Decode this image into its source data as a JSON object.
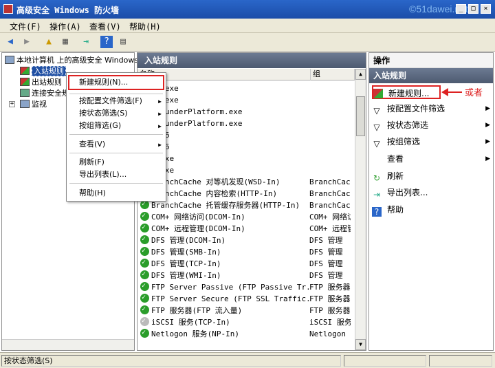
{
  "window": {
    "title": "高级安全 Windows 防火墙",
    "watermark": "©51dawei.net",
    "buttons": {
      "minimize": "_",
      "maximize": "□",
      "close": "×"
    }
  },
  "menu": [
    "文件(F)",
    "操作(A)",
    "查看(V)",
    "帮助(H)"
  ],
  "tree": {
    "root": "本地计算机 上的高级安全 Windows 防火墙",
    "items": [
      "入站规则",
      "出站规则",
      "连接安全规则",
      "监视"
    ]
  },
  "center": {
    "header": "入站规则",
    "columns": {
      "name": "名称",
      "group": "组"
    },
    "rows": [
      {
        "name": "se.exe",
        "group": ""
      },
      {
        "name": "se.exe",
        "group": ""
      },
      {
        "name": "iThunderPlatform.exe",
        "group": ""
      },
      {
        "name": "iThunderPlatform.exe",
        "group": ""
      },
      {
        "name": "QL56",
        "group": ""
      },
      {
        "name": "QL56",
        "group": ""
      },
      {
        "name": "p.exe",
        "group": ""
      },
      {
        "name": "p.exe",
        "group": ""
      },
      {
        "name": "BranchCache 对等机发现(WSD-In)",
        "group": "BranchCache"
      },
      {
        "name": "BranchCache 内容检索(HTTP-In)",
        "group": "BranchCache"
      },
      {
        "name": "BranchCache 托管缓存服务器(HTTP-In)",
        "group": "BranchCache"
      },
      {
        "name": "COM+ 网络访问(DCOM-In)",
        "group": "COM+ 网络访问"
      },
      {
        "name": "COM+ 远程管理(DCOM-In)",
        "group": "COM+ 远程管理"
      },
      {
        "name": "DFS 管理(DCOM-In)",
        "group": "DFS 管理"
      },
      {
        "name": "DFS 管理(SMB-In)",
        "group": "DFS 管理"
      },
      {
        "name": "DFS 管理(TCP-In)",
        "group": "DFS 管理"
      },
      {
        "name": "DFS 管理(WMI-In)",
        "group": "DFS 管理"
      },
      {
        "name": "FTP Server Passive (FTP Passive Tr...",
        "group": "FTP 服务器"
      },
      {
        "name": "FTP Server Secure (FTP SSL Traffic...",
        "group": "FTP 服务器"
      },
      {
        "name": "FTP 服务器(FTP 流入量)",
        "group": "FTP 服务器"
      },
      {
        "name": "iSCSI 服务(TCP-In)",
        "group": "iSCSI 服务"
      },
      {
        "name": "Netlogon 服务(NP-In)",
        "group": "Netlogon 服务"
      }
    ]
  },
  "actions": {
    "header": "操作",
    "subheader": "入站规则",
    "items": [
      "新建规则...",
      "按配置文件筛选",
      "按状态筛选",
      "按组筛选",
      "查看",
      "刷新",
      "导出列表...",
      "帮助"
    ]
  },
  "context_menu": [
    "新建规则(N)...",
    "按配置文件筛选(F)",
    "按状态筛选(S)",
    "按组筛选(G)",
    "查看(V)",
    "刷新(F)",
    "导出列表(L)...",
    "帮助(H)"
  ],
  "annotation": "或者",
  "status": "按状态筛选(S)",
  "colors": {
    "accent": "#d22222",
    "selection": "#1f4fa3",
    "header": "#4d5a70",
    "enabled": "#2a9d2a"
  }
}
